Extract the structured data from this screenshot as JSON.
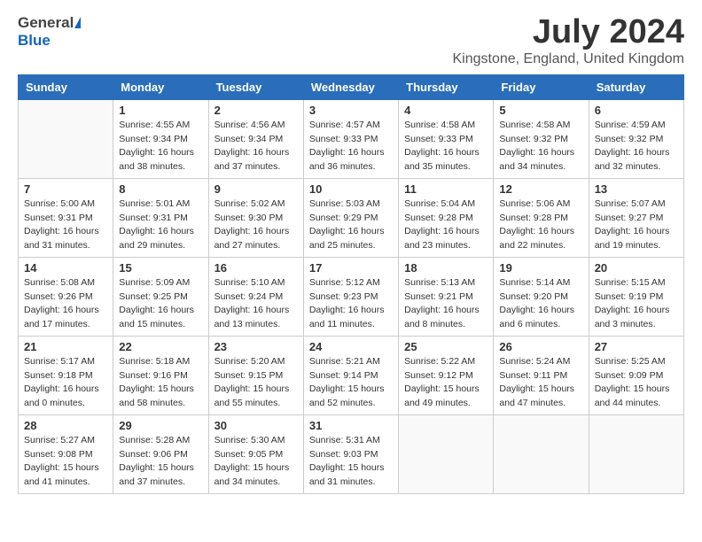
{
  "header": {
    "logo_general": "General",
    "logo_blue": "Blue",
    "month_year": "July 2024",
    "location": "Kingstone, England, United Kingdom"
  },
  "days_of_week": [
    "Sunday",
    "Monday",
    "Tuesday",
    "Wednesday",
    "Thursday",
    "Friday",
    "Saturday"
  ],
  "weeks": [
    [
      {
        "day": "",
        "info": ""
      },
      {
        "day": "1",
        "info": "Sunrise: 4:55 AM\nSunset: 9:34 PM\nDaylight: 16 hours\nand 38 minutes."
      },
      {
        "day": "2",
        "info": "Sunrise: 4:56 AM\nSunset: 9:34 PM\nDaylight: 16 hours\nand 37 minutes."
      },
      {
        "day": "3",
        "info": "Sunrise: 4:57 AM\nSunset: 9:33 PM\nDaylight: 16 hours\nand 36 minutes."
      },
      {
        "day": "4",
        "info": "Sunrise: 4:58 AM\nSunset: 9:33 PM\nDaylight: 16 hours\nand 35 minutes."
      },
      {
        "day": "5",
        "info": "Sunrise: 4:58 AM\nSunset: 9:32 PM\nDaylight: 16 hours\nand 34 minutes."
      },
      {
        "day": "6",
        "info": "Sunrise: 4:59 AM\nSunset: 9:32 PM\nDaylight: 16 hours\nand 32 minutes."
      }
    ],
    [
      {
        "day": "7",
        "info": "Sunrise: 5:00 AM\nSunset: 9:31 PM\nDaylight: 16 hours\nand 31 minutes."
      },
      {
        "day": "8",
        "info": "Sunrise: 5:01 AM\nSunset: 9:31 PM\nDaylight: 16 hours\nand 29 minutes."
      },
      {
        "day": "9",
        "info": "Sunrise: 5:02 AM\nSunset: 9:30 PM\nDaylight: 16 hours\nand 27 minutes."
      },
      {
        "day": "10",
        "info": "Sunrise: 5:03 AM\nSunset: 9:29 PM\nDaylight: 16 hours\nand 25 minutes."
      },
      {
        "day": "11",
        "info": "Sunrise: 5:04 AM\nSunset: 9:28 PM\nDaylight: 16 hours\nand 23 minutes."
      },
      {
        "day": "12",
        "info": "Sunrise: 5:06 AM\nSunset: 9:28 PM\nDaylight: 16 hours\nand 22 minutes."
      },
      {
        "day": "13",
        "info": "Sunrise: 5:07 AM\nSunset: 9:27 PM\nDaylight: 16 hours\nand 19 minutes."
      }
    ],
    [
      {
        "day": "14",
        "info": "Sunrise: 5:08 AM\nSunset: 9:26 PM\nDaylight: 16 hours\nand 17 minutes."
      },
      {
        "day": "15",
        "info": "Sunrise: 5:09 AM\nSunset: 9:25 PM\nDaylight: 16 hours\nand 15 minutes."
      },
      {
        "day": "16",
        "info": "Sunrise: 5:10 AM\nSunset: 9:24 PM\nDaylight: 16 hours\nand 13 minutes."
      },
      {
        "day": "17",
        "info": "Sunrise: 5:12 AM\nSunset: 9:23 PM\nDaylight: 16 hours\nand 11 minutes."
      },
      {
        "day": "18",
        "info": "Sunrise: 5:13 AM\nSunset: 9:21 PM\nDaylight: 16 hours\nand 8 minutes."
      },
      {
        "day": "19",
        "info": "Sunrise: 5:14 AM\nSunset: 9:20 PM\nDaylight: 16 hours\nand 6 minutes."
      },
      {
        "day": "20",
        "info": "Sunrise: 5:15 AM\nSunset: 9:19 PM\nDaylight: 16 hours\nand 3 minutes."
      }
    ],
    [
      {
        "day": "21",
        "info": "Sunrise: 5:17 AM\nSunset: 9:18 PM\nDaylight: 16 hours\nand 0 minutes."
      },
      {
        "day": "22",
        "info": "Sunrise: 5:18 AM\nSunset: 9:16 PM\nDaylight: 15 hours\nand 58 minutes."
      },
      {
        "day": "23",
        "info": "Sunrise: 5:20 AM\nSunset: 9:15 PM\nDaylight: 15 hours\nand 55 minutes."
      },
      {
        "day": "24",
        "info": "Sunrise: 5:21 AM\nSunset: 9:14 PM\nDaylight: 15 hours\nand 52 minutes."
      },
      {
        "day": "25",
        "info": "Sunrise: 5:22 AM\nSunset: 9:12 PM\nDaylight: 15 hours\nand 49 minutes."
      },
      {
        "day": "26",
        "info": "Sunrise: 5:24 AM\nSunset: 9:11 PM\nDaylight: 15 hours\nand 47 minutes."
      },
      {
        "day": "27",
        "info": "Sunrise: 5:25 AM\nSunset: 9:09 PM\nDaylight: 15 hours\nand 44 minutes."
      }
    ],
    [
      {
        "day": "28",
        "info": "Sunrise: 5:27 AM\nSunset: 9:08 PM\nDaylight: 15 hours\nand 41 minutes."
      },
      {
        "day": "29",
        "info": "Sunrise: 5:28 AM\nSunset: 9:06 PM\nDaylight: 15 hours\nand 37 minutes."
      },
      {
        "day": "30",
        "info": "Sunrise: 5:30 AM\nSunset: 9:05 PM\nDaylight: 15 hours\nand 34 minutes."
      },
      {
        "day": "31",
        "info": "Sunrise: 5:31 AM\nSunset: 9:03 PM\nDaylight: 15 hours\nand 31 minutes."
      },
      {
        "day": "",
        "info": ""
      },
      {
        "day": "",
        "info": ""
      },
      {
        "day": "",
        "info": ""
      }
    ]
  ]
}
